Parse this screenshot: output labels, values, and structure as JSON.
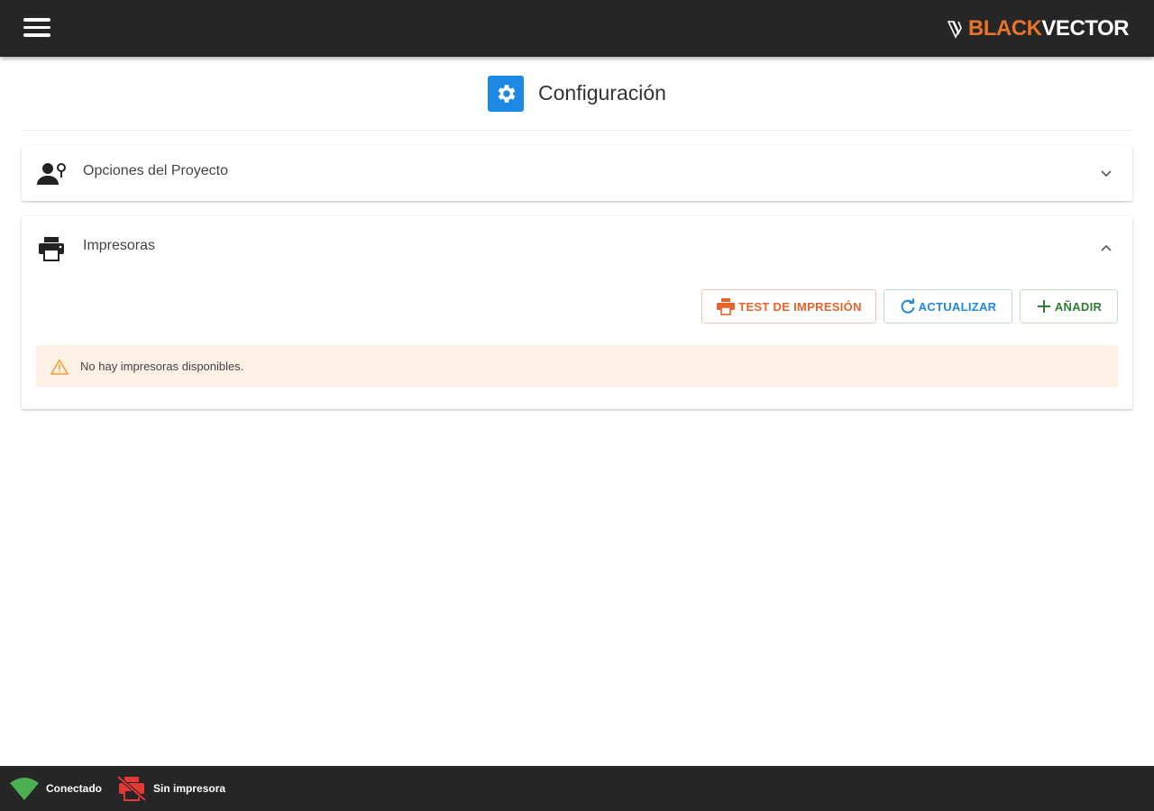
{
  "topbar": {
    "menu_icon": "hamburger-menu-icon",
    "logo": {
      "part1": "BLACK",
      "part2": "VECTOR",
      "accent": "#e8732a"
    }
  },
  "header": {
    "icon": "gear-icon",
    "title": "Configuración"
  },
  "panels": [
    {
      "icon": "user-settings-icon",
      "title": "Opciones del Proyecto",
      "expanded": false
    },
    {
      "icon": "printer-icon",
      "title": "Impresoras",
      "expanded": true,
      "actions": [
        {
          "icon": "printer-icon",
          "label": "TEST DE IMPRESIÓN",
          "color": "#e8632a"
        },
        {
          "icon": "refresh-icon",
          "label": "ACTUALIZAR",
          "color": "#1e88e5"
        },
        {
          "icon": "plus-icon",
          "label": "AÑADIR",
          "color": "#2e7d32"
        }
      ],
      "alert": {
        "icon": "warning-icon",
        "text": "No hay impresoras disponibles.",
        "bg": "#fdf1e6"
      }
    }
  ],
  "statusbar": {
    "connection": {
      "icon": "wifi-icon",
      "label": "Conectado",
      "color": "#4caf50"
    },
    "printer": {
      "icon": "printer-off-icon",
      "label": "Sin impresora",
      "color": "#e53935"
    }
  }
}
